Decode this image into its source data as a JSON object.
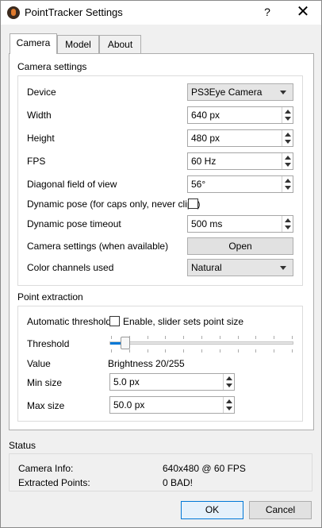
{
  "window": {
    "title": "PointTracker Settings",
    "help": "?",
    "close": "✕"
  },
  "tabs": [
    {
      "label": "Camera",
      "active": true
    },
    {
      "label": "Model",
      "active": false
    },
    {
      "label": "About",
      "active": false
    }
  ],
  "camera_settings": {
    "title": "Camera settings",
    "device_label": "Device",
    "device_value": "PS3Eye Camera",
    "width_label": "Width",
    "width_value": "640 px",
    "height_label": "Height",
    "height_value": "480 px",
    "fps_label": "FPS",
    "fps_value": "60 Hz",
    "fov_label": "Diagonal field of view",
    "fov_value": "56°",
    "dynpose_label": "Dynamic pose (for caps only, never clips)",
    "dynpose_checked": false,
    "dynpose_timeout_label": "Dynamic pose timeout",
    "dynpose_timeout_value": "500 ms",
    "camsettings_label": "Camera settings (when available)",
    "camsettings_button": "Open",
    "color_label": "Color channels used",
    "color_value": "Natural"
  },
  "point_extraction": {
    "title": "Point extraction",
    "auto_threshold_label": "Automatic threshold",
    "auto_threshold_checkbox_label": "Enable, slider sets point size",
    "auto_threshold_checked": false,
    "threshold_label": "Threshold",
    "threshold_level": 0.08,
    "value_label": "Value",
    "value_text": "Brightness 20/255",
    "min_size_label": "Min size",
    "min_size_value": "5.0 px",
    "max_size_label": "Max size",
    "max_size_value": "50.0 px"
  },
  "status": {
    "title": "Status",
    "camera_info_label": "Camera Info:",
    "camera_info_value": "640x480 @ 60 FPS",
    "extracted_label": "Extracted Points:",
    "extracted_value": "0 BAD!"
  },
  "buttons": {
    "ok": "OK",
    "cancel": "Cancel"
  },
  "colors": {
    "accent": "#0078d7",
    "background": "#f0f0f0"
  }
}
